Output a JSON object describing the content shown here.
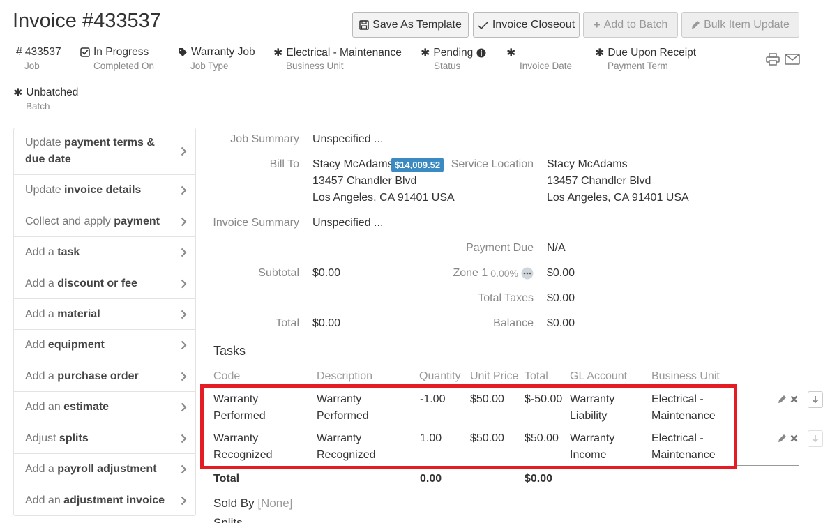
{
  "header": {
    "title": "Invoice #433537",
    "buttons": {
      "save_template": "Save As Template",
      "closeout": "Invoice Closeout",
      "add_batch": "Add to Batch",
      "bulk_update": "Bulk Item Update"
    }
  },
  "meta": {
    "job": {
      "value": "# 433537",
      "label": "Job"
    },
    "completed": {
      "value": "In Progress",
      "label": "Completed On"
    },
    "job_type": {
      "value": "Warranty Job",
      "label": "Job Type"
    },
    "business_unit": {
      "value": "Electrical - Maintenance",
      "label": "Business Unit"
    },
    "status": {
      "value": "Pending",
      "label": "Status"
    },
    "invoice_date": {
      "value": "",
      "label": "Invoice Date"
    },
    "payment_term": {
      "value": "Due Upon Receipt",
      "label": "Payment Term"
    },
    "batch": {
      "value": "Unbatched",
      "label": "Batch"
    }
  },
  "sidebar": {
    "items": [
      {
        "pre": "Update ",
        "bold": "payment terms & due date"
      },
      {
        "pre": "Update ",
        "bold": "invoice details"
      },
      {
        "pre": "Collect and apply ",
        "bold": "payment"
      },
      {
        "pre": "Add a ",
        "bold": "task"
      },
      {
        "pre": "Add a ",
        "bold": "discount or fee"
      },
      {
        "pre": "Add a ",
        "bold": "material"
      },
      {
        "pre": "Add ",
        "bold": "equipment"
      },
      {
        "pre": "Add a ",
        "bold": "purchase order"
      },
      {
        "pre": "Add an ",
        "bold": "estimate"
      },
      {
        "pre": "Adjust ",
        "bold": "splits"
      },
      {
        "pre": "Add a ",
        "bold": "payroll adjustment"
      },
      {
        "pre": "Add an ",
        "bold": "adjustment invoice"
      }
    ]
  },
  "summary": {
    "job_summary_label": "Job Summary",
    "job_summary_value": "Unspecified ...",
    "bill_to_label": "Bill To",
    "bill_to_name": "Stacy McAdams",
    "bill_to_balance": "$14,009.52",
    "bill_to_addr1": "13457 Chandler Blvd",
    "bill_to_addr2": "Los Angeles, CA 91401 USA",
    "service_location_label": "Service Location",
    "service_name": "Stacy McAdams",
    "service_addr1": "13457 Chandler Blvd",
    "service_addr2": "Los Angeles, CA 91401 USA",
    "invoice_summary_label": "Invoice Summary",
    "invoice_summary_value": "Unspecified ...",
    "payment_due_label": "Payment Due",
    "payment_due_value": "N/A",
    "subtotal_label": "Subtotal",
    "subtotal_value": "$0.00",
    "zone_label": "Zone 1",
    "zone_pct": "0.00%",
    "zone_value": "$0.00",
    "total_taxes_label": "Total Taxes",
    "total_taxes_value": "$0.00",
    "total_label": "Total",
    "total_value": "$0.00",
    "balance_label": "Balance",
    "balance_value": "$0.00"
  },
  "tasks": {
    "heading": "Tasks",
    "columns": [
      "Code",
      "Description",
      "Quantity",
      "Unit Price",
      "Total",
      "GL Account",
      "Business Unit"
    ],
    "rows": [
      {
        "code": "Warranty Performed",
        "description": "Warranty Performed",
        "quantity": "-1.00",
        "unit_price": "$50.00",
        "total": "$-50.00",
        "gl_account": "Warranty Liability",
        "business_unit": "Electrical - Maintenance"
      },
      {
        "code": "Warranty Recognized",
        "description": "Warranty Recognized",
        "quantity": "1.00",
        "unit_price": "$50.00",
        "total": "$50.00",
        "gl_account": "Warranty Income",
        "business_unit": "Electrical - Maintenance"
      }
    ],
    "footer_label": "Total",
    "footer_quantity": "0.00",
    "footer_total": "$0.00"
  },
  "sold_by": {
    "label": "Sold By",
    "value": "[None]"
  },
  "splits_label": "Splits",
  "colors": {
    "accent": "#3b8bc2",
    "highlight": "#e41c24"
  }
}
